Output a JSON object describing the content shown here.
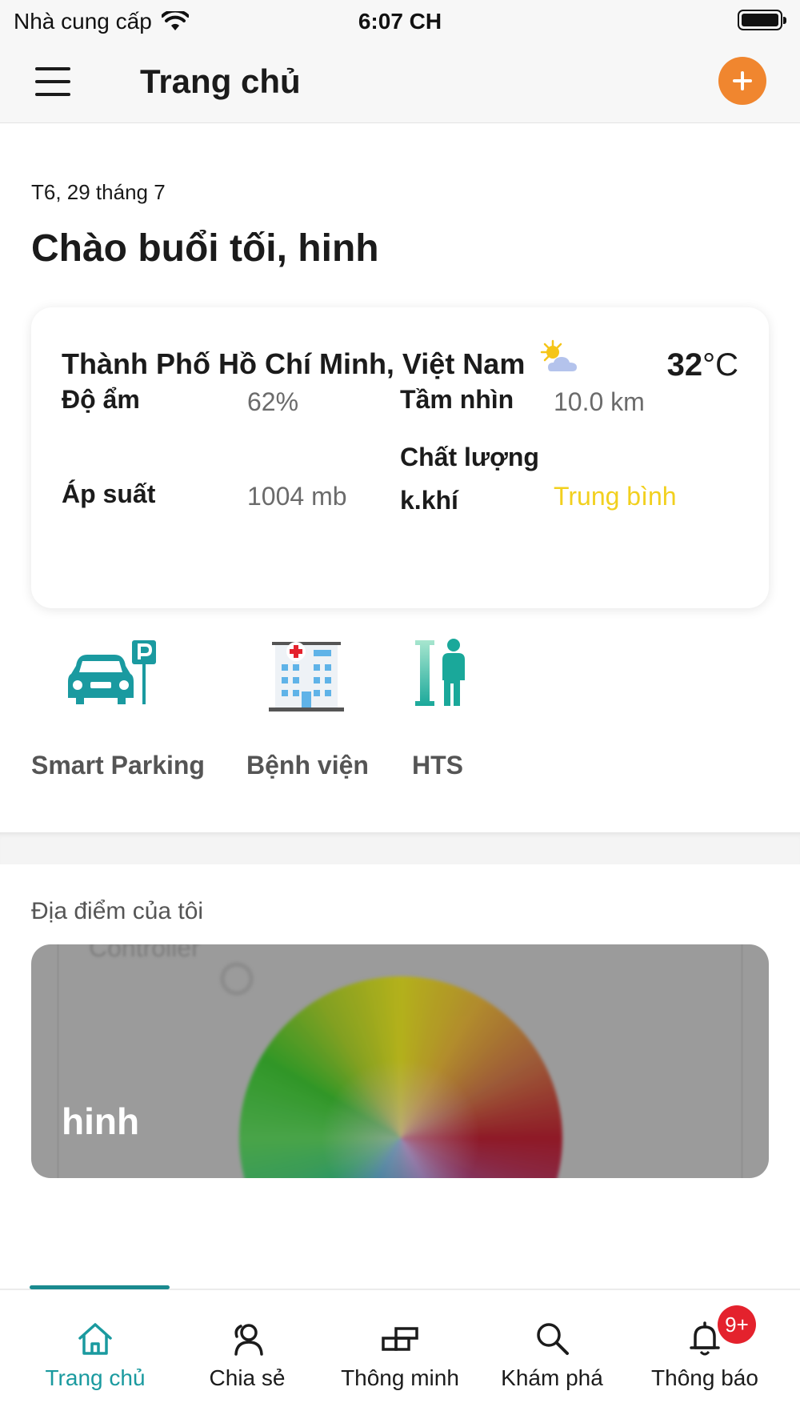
{
  "status_bar": {
    "carrier": "Nhà cung cấp",
    "time": "6:07 CH"
  },
  "header": {
    "title": "Trang chủ",
    "menu_icon": "hamburger-menu-icon",
    "add_icon": "plus-icon"
  },
  "greeting": {
    "date": "T6, 29 tháng 7",
    "message": "Chào buổi tối, hinh"
  },
  "weather": {
    "location": "Thành Phố Hồ Chí Minh, Việt Nam",
    "icon": "partly-cloudy-icon",
    "temperature": "32",
    "unit": "°C",
    "humidity_label": "Độ ẩm",
    "humidity_value": "62%",
    "visibility_label": "Tầm nhìn",
    "visibility_value": "10.0 km",
    "pressure_label": "Áp suất",
    "pressure_value": "1004 mb",
    "air_quality_label_line1": "Chất lượng",
    "air_quality_label_line2": "k.khí",
    "air_quality_value": "Trung bình",
    "air_quality_color": "#f2d01e"
  },
  "shortcuts": [
    {
      "label": "Smart Parking",
      "icon": "parking-car-icon"
    },
    {
      "label": "Bệnh viện",
      "icon": "hospital-icon"
    },
    {
      "label": "HTS",
      "icon": "hts-logo-icon"
    }
  ],
  "places": {
    "title": "Địa điểm của tôi",
    "items": [
      {
        "name": "hinh",
        "background_text": "Controller"
      }
    ]
  },
  "bottom_nav": {
    "accent": "#1a9a9f",
    "items": [
      {
        "label": "Trang chủ",
        "icon": "home-icon",
        "active": true
      },
      {
        "label": "Chia sẻ",
        "icon": "share-user-icon"
      },
      {
        "label": "Thông minh",
        "icon": "smart-blocks-icon"
      },
      {
        "label": "Khám phá",
        "icon": "search-icon"
      },
      {
        "label": "Thông báo",
        "icon": "bell-icon",
        "badge": "9+"
      }
    ]
  }
}
